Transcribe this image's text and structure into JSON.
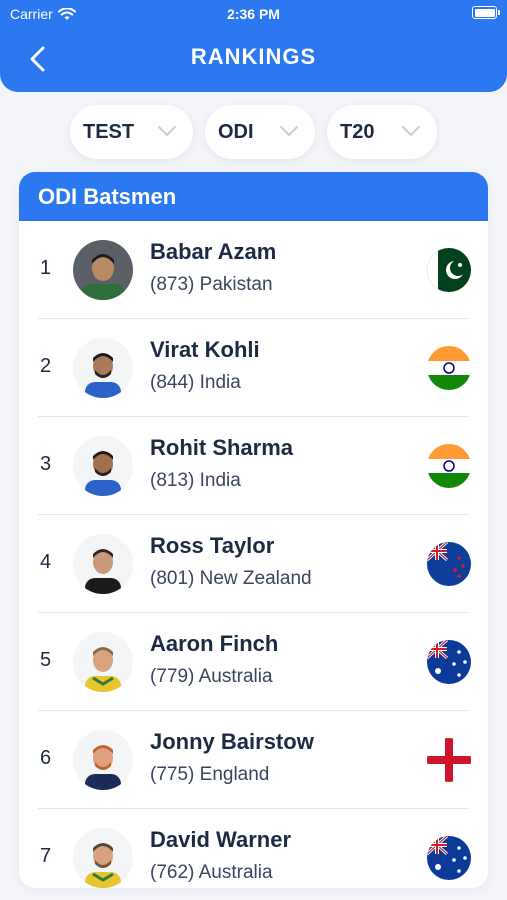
{
  "status_bar": {
    "carrier": "Carrier",
    "time": "2:36 PM"
  },
  "header": {
    "title": "RANKINGS",
    "back_icon": "chevron-left-icon"
  },
  "tabs": [
    {
      "label": "TEST"
    },
    {
      "label": "ODI"
    },
    {
      "label": "T20"
    }
  ],
  "section": {
    "title": "ODI Batsmen"
  },
  "colors": {
    "primary": "#2b78f0",
    "text": "#1d2a44",
    "background": "#f3f5f9"
  },
  "rankings": [
    {
      "rank": "1",
      "name": "Babar Azam",
      "rating": "873",
      "country": "Pakistan",
      "flag_icon": "pakistan-flag-icon"
    },
    {
      "rank": "2",
      "name": "Virat Kohli",
      "rating": "844",
      "country": "India",
      "flag_icon": "india-flag-icon"
    },
    {
      "rank": "3",
      "name": "Rohit Sharma",
      "rating": "813",
      "country": "India",
      "flag_icon": "india-flag-icon"
    },
    {
      "rank": "4",
      "name": "Ross Taylor",
      "rating": "801",
      "country": "New Zealand",
      "flag_icon": "new-zealand-flag-icon"
    },
    {
      "rank": "5",
      "name": "Aaron Finch",
      "rating": "779",
      "country": "Australia",
      "flag_icon": "australia-flag-icon"
    },
    {
      "rank": "6",
      "name": "Jonny Bairstow",
      "rating": "775",
      "country": "England",
      "flag_icon": "england-flag-icon"
    },
    {
      "rank": "7",
      "name": "David Warner",
      "rating": "762",
      "country": "Australia",
      "flag_icon": "australia-flag-icon"
    }
  ]
}
